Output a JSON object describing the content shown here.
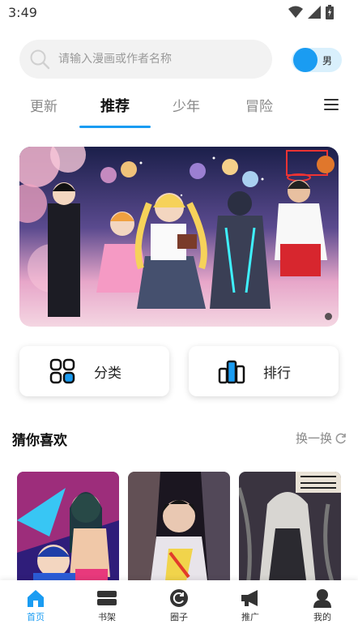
{
  "status_bar": {
    "time": "3:49"
  },
  "search": {
    "placeholder": "请输入漫画或作者名称"
  },
  "gender_toggle": {
    "label": "男"
  },
  "tabs": [
    {
      "label": "更新",
      "active": false
    },
    {
      "label": "推荐",
      "active": true
    },
    {
      "label": "少年",
      "active": false
    },
    {
      "label": "冒险",
      "active": false
    }
  ],
  "quick_actions": {
    "category_label": "分类",
    "ranking_label": "排行"
  },
  "recommend": {
    "title": "猜你喜欢",
    "refresh_label": "换一换"
  },
  "bottom_nav": [
    {
      "label": "首页",
      "icon": "home-icon",
      "active": true
    },
    {
      "label": "书架",
      "icon": "bookshelf-icon",
      "active": false
    },
    {
      "label": "圈子",
      "icon": "circle-icon",
      "active": false
    },
    {
      "label": "推广",
      "icon": "megaphone-icon",
      "active": false
    },
    {
      "label": "我的",
      "icon": "profile-icon",
      "active": false
    }
  ],
  "colors": {
    "accent": "#1a9cf2",
    "toggle_bg": "#d9f0fc"
  }
}
